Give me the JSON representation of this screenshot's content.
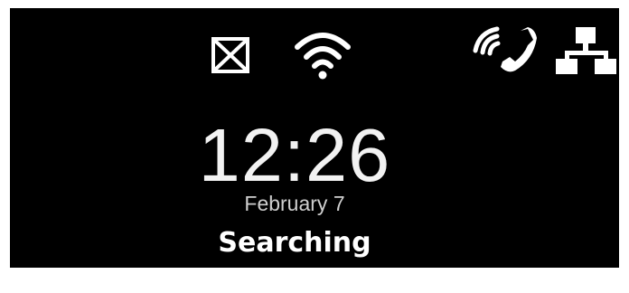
{
  "status_icons": {
    "mail": "mail-icon",
    "wifi": "wifi-icon",
    "wifi_calling": "wifi-calling-icon",
    "network": "network-icon"
  },
  "clock": {
    "time": "12:26",
    "date": "February 7"
  },
  "status": {
    "text": "Searching"
  },
  "colors": {
    "background": "#000000",
    "foreground": "#ffffff"
  }
}
